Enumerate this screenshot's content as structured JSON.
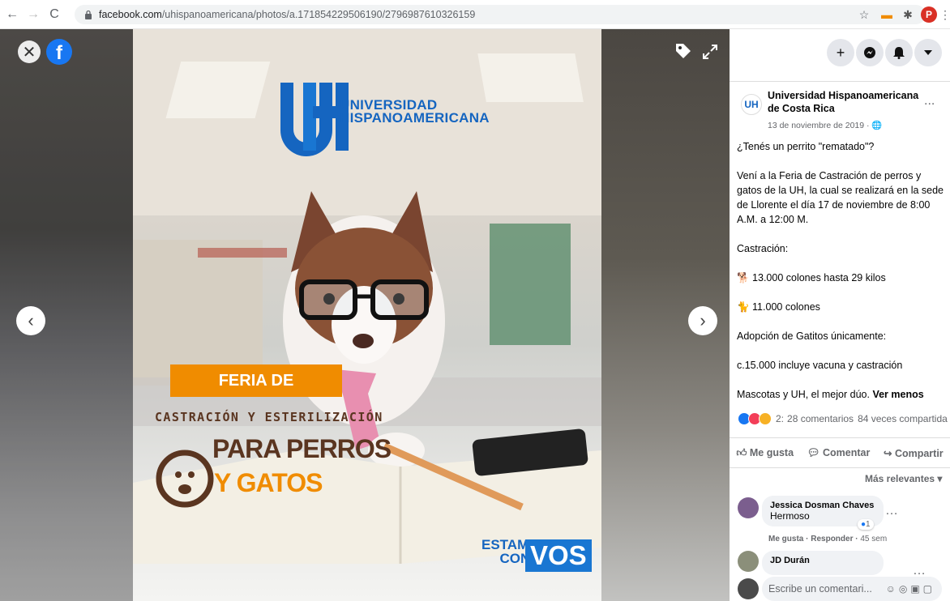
{
  "browser": {
    "url_host": "facebook.com",
    "url_path": "/uhispanoamericana/photos/a.171854229506190/2796987610326159",
    "profile_initial": "P"
  },
  "poster": {
    "logo_line1": "UNIVERSIDAD",
    "logo_line2": "HISPANOAMERICANA",
    "feria": "FERIA DE",
    "castracion": "CASTRACIÓN Y ESTERILIZACIÓN",
    "para_perros": "PARA PERROS",
    "y_gatos": "Y GATOS",
    "estamos": "ESTAMOS",
    "con": "CON",
    "vos": "VOS"
  },
  "post": {
    "page_name": "Universidad Hispanoamericana de Costa Rica",
    "date": "13 de noviembre de 2019 · ",
    "more": "...",
    "paragraphs": [
      "¿Tenés un perrito \"rematado\"?",
      "Vení a la Feria de Castración de perros y gatos de la UH, la cual se realizará en la sede de Llorente el día 17 de noviembre de 8:00 A.M. a 12:00 M.",
      "Castración:",
      "🐕 13.000 colones hasta 29 kilos",
      "🐈 11.000 colones",
      "Adopción de Gatitos únicamente:",
      "c.15.000 incluye vacuna y castración"
    ],
    "last_line": "Mascotas y UH, el mejor dúo.",
    "see_less": "Ver menos",
    "reaction_count": "2:",
    "comments_count": "28 comentarios",
    "shares": "84 veces compartida"
  },
  "actions": {
    "like": "Me gusta",
    "comment": "Comentar",
    "share": "Compartir"
  },
  "sort_label": "Más relevantes",
  "comments": [
    {
      "name": "Jessica Dosman Chaves",
      "text": "Hermoso",
      "likes": "1",
      "meta_like": "Me gusta",
      "meta_reply": "Responder",
      "time": "45 sem"
    },
    {
      "name": "JD Durán",
      "text": ""
    }
  ],
  "comment_placeholder": "Escribe un comentari...",
  "colors": {
    "facebook_blue": "#1877f2",
    "uh_blue": "#1565c0",
    "poster_orange": "#f08c00",
    "poster_brown": "#5a3520"
  }
}
